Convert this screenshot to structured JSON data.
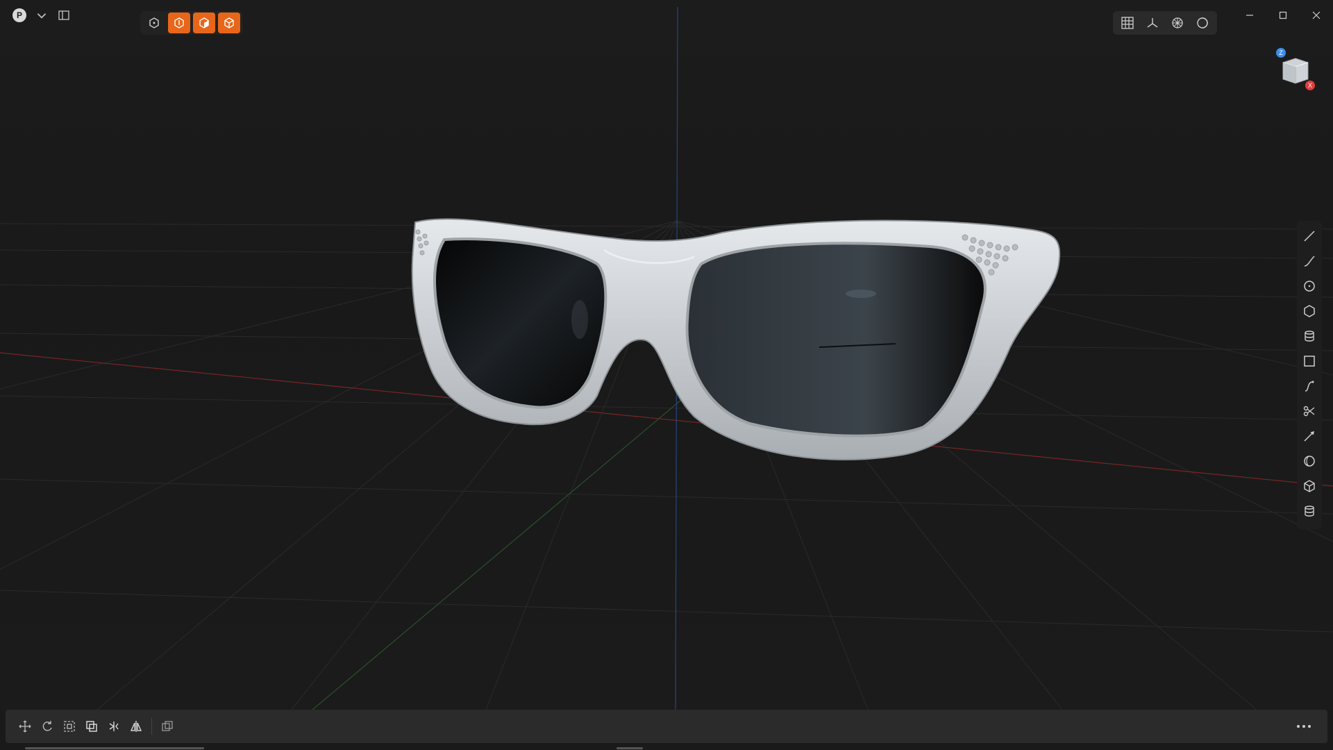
{
  "app": {
    "avatar_letter": "P",
    "accent_color": "#e8661a"
  },
  "top_left": {
    "icons": [
      "avatar",
      "chevron-down-icon",
      "sidebar-toggle-icon"
    ]
  },
  "mode_toolbar": {
    "buttons": [
      {
        "icon": "object-mode-icon",
        "active": false
      },
      {
        "icon": "vertex-mode-icon",
        "active": true
      },
      {
        "icon": "face-mode-icon",
        "active": true
      },
      {
        "icon": "edge-mode-icon",
        "active": true
      }
    ]
  },
  "view_toolbar": {
    "buttons": [
      "grid-view-icon",
      "axes-view-icon",
      "wireframe-view-icon",
      "shading-view-icon"
    ]
  },
  "window_controls": [
    "minimize-icon",
    "maximize-icon",
    "close-icon"
  ],
  "gizmo": {
    "z_label": "Z",
    "x_label": "X",
    "z_color": "#3a8ee6",
    "x_color": "#e23c3c"
  },
  "right_tools": [
    "line-tool-icon",
    "curve-tool-icon",
    "circle-tool-icon",
    "polygon-tool-icon",
    "stack-tool-icon",
    "rectangle-tool-icon",
    "spline-tool-icon",
    "cut-tool-icon",
    "knife-tool-icon",
    "sphere-tool-icon",
    "cube-tool-icon",
    "cylinder-tool-icon"
  ],
  "bottom_tools": [
    "move-icon",
    "rotate-icon",
    "scale-icon",
    "duplicate-icon",
    "align-icon",
    "mirror-icon",
    "boolean-icon"
  ],
  "more_icon": "more-horizontal-icon",
  "scene": {
    "object": "sunglasses",
    "frame_color": "#d4d8dc",
    "axis_x_color": "#8a2a2a",
    "axis_y_color": "#2e5a2e",
    "axis_z_color": "#2a4a8a"
  }
}
